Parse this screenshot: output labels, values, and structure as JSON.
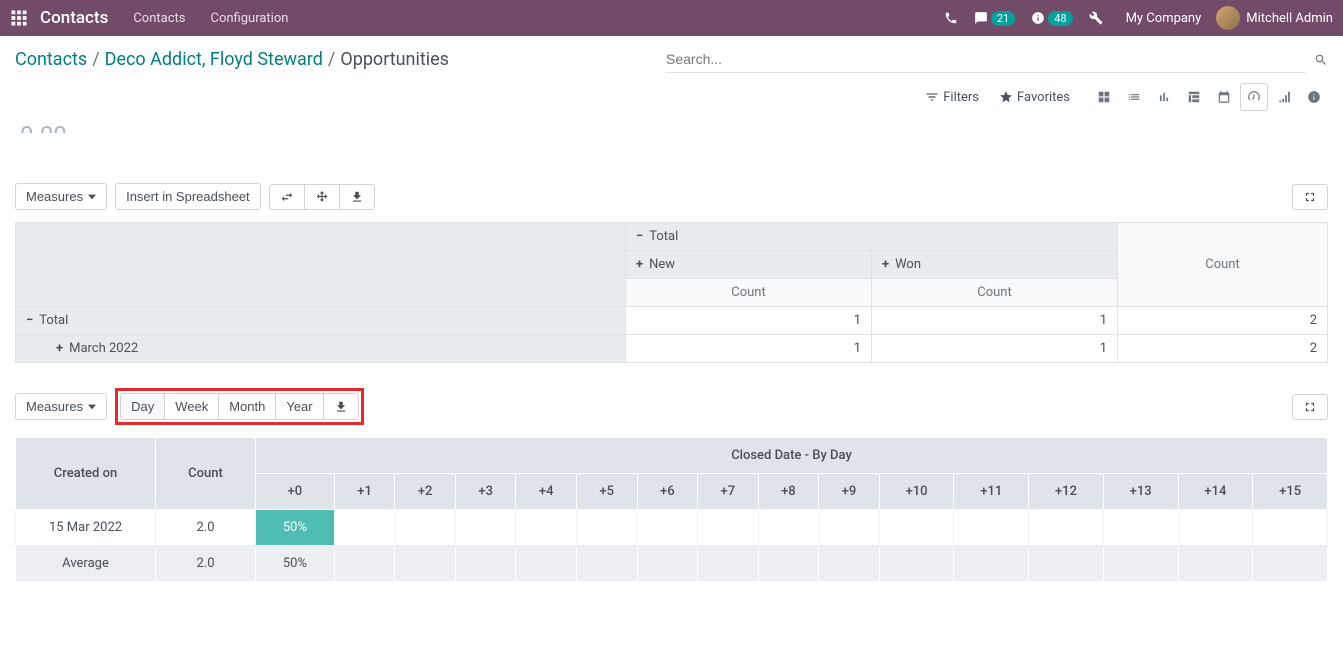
{
  "navbar": {
    "brand": "Contacts",
    "links": [
      "Contacts",
      "Configuration"
    ],
    "msg_badge": "21",
    "act_badge": "48",
    "company": "My Company",
    "user": "Mitchell Admin"
  },
  "breadcrumb": {
    "a": "Contacts",
    "b": "Deco Addict, Floyd Steward",
    "c": "Opportunities"
  },
  "search": {
    "placeholder": "Search..."
  },
  "filters": {
    "filters_label": "Filters",
    "favorites_label": "Favorites"
  },
  "pivot": {
    "measures_label": "Measures",
    "insert_label": "Insert in Spreadsheet",
    "total_label": "Total",
    "new_label": "New",
    "won_label": "Won",
    "count_label": "Count",
    "row_total": "Total",
    "row_month": "March 2022",
    "vals": {
      "total_new": "1",
      "total_won": "1",
      "total_total": "2",
      "month_new": "1",
      "month_won": "1",
      "month_total": "2"
    }
  },
  "cohort": {
    "measures_label": "Measures",
    "periods": {
      "day": "Day",
      "week": "Week",
      "month": "Month",
      "year": "Year"
    },
    "created_on_label": "Created on",
    "count_label": "Count",
    "closed_label": "Closed Date - By Day",
    "offsets": [
      "+0",
      "+1",
      "+2",
      "+3",
      "+4",
      "+5",
      "+6",
      "+7",
      "+8",
      "+9",
      "+10",
      "+11",
      "+12",
      "+13",
      "+14",
      "+15"
    ],
    "row_date": "15 Mar 2022",
    "row_count": "2.0",
    "row_pct": "50%",
    "avg_label": "Average",
    "avg_count": "2.0",
    "avg_pct": "50%"
  }
}
